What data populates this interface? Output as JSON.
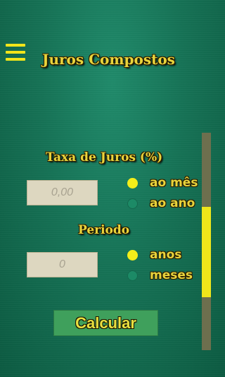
{
  "app": {
    "title": "Juros Compostos"
  },
  "menu": {
    "icon": "hamburger-menu-icon"
  },
  "taxa": {
    "label": "Taxa de Juros (%)",
    "placeholder": "0,00",
    "options": [
      {
        "label": "ao mês",
        "selected": true
      },
      {
        "label": "ao ano",
        "selected": false
      }
    ]
  },
  "periodo": {
    "label": "Periodo",
    "placeholder": "0",
    "options": [
      {
        "label": "anos",
        "selected": true
      },
      {
        "label": "meses",
        "selected": false
      }
    ]
  },
  "actions": {
    "calculate_label": "Calcular"
  },
  "colors": {
    "accent": "#e8d43c",
    "background": "#157255",
    "button": "#3fa05c",
    "radio_selected": "#f5ee1a",
    "radio_unselected": "#1c8a66"
  },
  "scrollbar": {
    "thumb_position_fraction": 0.34
  }
}
